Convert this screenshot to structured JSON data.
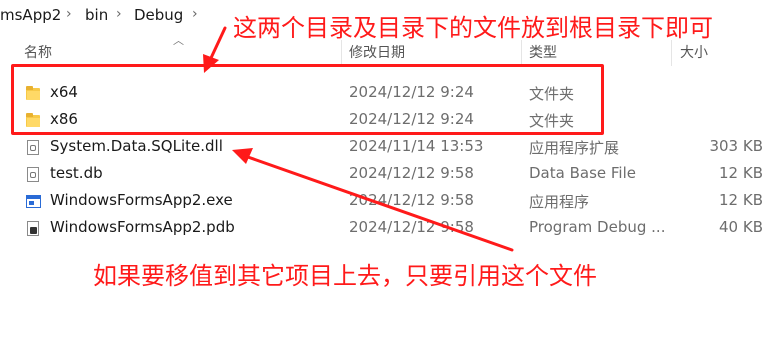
{
  "breadcrumb": {
    "items": [
      "msApp2",
      "bin",
      "Debug"
    ],
    "separator": "›"
  },
  "columns": {
    "name": "名称",
    "date": "修改日期",
    "type": "类型",
    "size": "大小"
  },
  "files": [
    {
      "name": "x64",
      "date": "2024/12/12 9:24",
      "type": "文件夹",
      "size": "",
      "icon": "folder-icon"
    },
    {
      "name": "x86",
      "date": "2024/12/12 9:24",
      "type": "文件夹",
      "size": "",
      "icon": "folder-icon"
    },
    {
      "name": "System.Data.SQLite.dll",
      "date": "2024/11/14 13:53",
      "type": "应用程序扩展",
      "size": "303 KB",
      "icon": "dll-file-icon"
    },
    {
      "name": "test.db",
      "date": "2024/12/12 9:58",
      "type": "Data Base File",
      "size": "12 KB",
      "icon": "db-file-icon"
    },
    {
      "name": "WindowsFormsApp2.exe",
      "date": "2024/12/12 9:58",
      "type": "应用程序",
      "size": "12 KB",
      "icon": "exe-file-icon"
    },
    {
      "name": "WindowsFormsApp2.pdb",
      "date": "2024/12/12 9:58",
      "type": "Program Debug ...",
      "size": "40 KB",
      "icon": "pdb-file-icon"
    }
  ],
  "annotations": {
    "top": "这两个目录及目录下的文件放到根目录下即可",
    "bottom": "如果要移值到其它项目上去，只要引用这个文件"
  },
  "colors": {
    "annotation": "#ff1a1a",
    "folder": "#f7c948"
  }
}
